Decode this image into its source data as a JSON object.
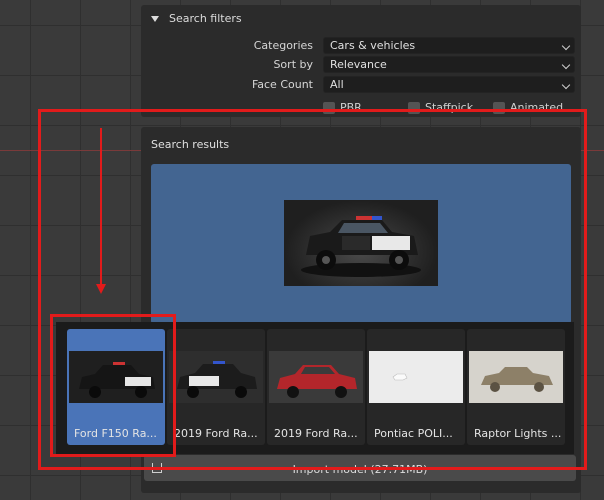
{
  "search_filters": {
    "title": "Search filters",
    "rows": [
      {
        "label": "Categories",
        "value": "Cars & vehicles"
      },
      {
        "label": "Sort by",
        "value": "Relevance"
      },
      {
        "label": "Face Count",
        "value": "All"
      }
    ],
    "checkboxes": [
      {
        "label": "PBR",
        "checked": false
      },
      {
        "label": "Staffpick",
        "checked": false
      },
      {
        "label": "Animated",
        "checked": false
      }
    ]
  },
  "results": {
    "title": "Search results",
    "items": [
      {
        "label": "Ford F150 Ra...",
        "selected": true
      },
      {
        "label": "2019 Ford Ra...",
        "selected": false
      },
      {
        "label": "2019 Ford Ra...",
        "selected": false
      },
      {
        "label": "Pontiac POLI...",
        "selected": false
      },
      {
        "label": "Raptor Lights ...",
        "selected": false
      }
    ]
  },
  "import": {
    "label": "Import model (27.71MB)",
    "icon": "download-icon"
  },
  "annotation_color": "#e21b1b",
  "selection_color": "#4a74b8",
  "preview_bg": "#436591"
}
